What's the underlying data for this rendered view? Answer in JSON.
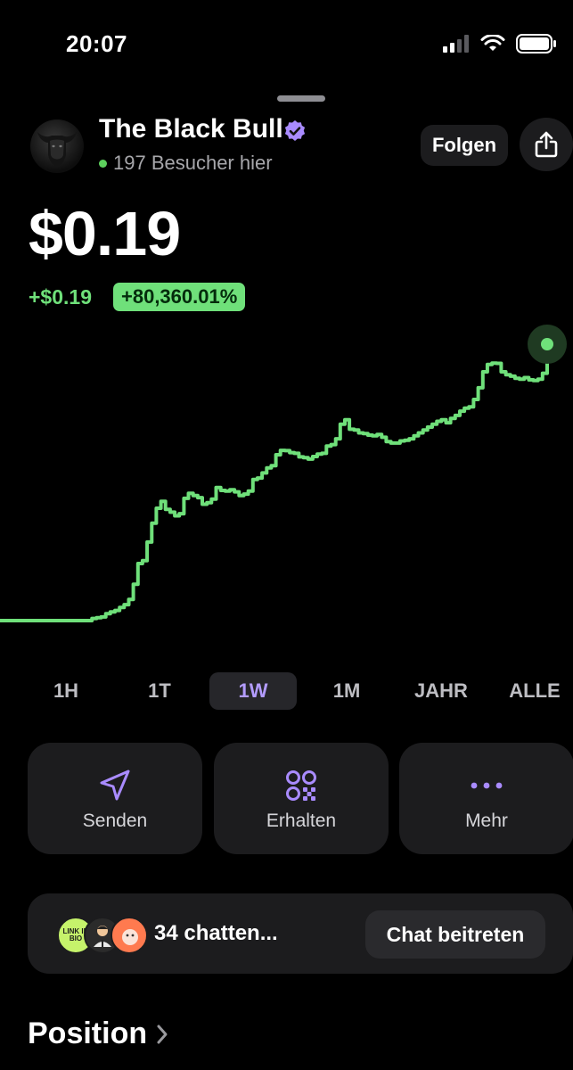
{
  "status_bar": {
    "time": "20:07"
  },
  "token": {
    "name": "The Black Bull",
    "visitors": "197 Besucher hier",
    "follow_label": "Folgen",
    "price": "$0.19",
    "change_abs": "+$0.19",
    "change_pct": "+80,360.01%"
  },
  "time_ranges": [
    {
      "label": "1H"
    },
    {
      "label": "1T"
    },
    {
      "label": "1W",
      "active": true
    },
    {
      "label": "1M"
    },
    {
      "label": "JAHR"
    },
    {
      "label": "ALLE"
    }
  ],
  "actions": {
    "send_label": "Senden",
    "receive_label": "Erhalten",
    "more_label": "Mehr"
  },
  "chat": {
    "count_text": "34 chatten...",
    "join_label": "Chat beitreten",
    "avatar1_text": "LINK IN BIO"
  },
  "position": {
    "title": "Position"
  },
  "colors": {
    "accent_green": "#6fe07a",
    "accent_purple": "#a98bff",
    "background": "#000000",
    "card": "#1c1c1e"
  },
  "chart_data": {
    "type": "line",
    "title": "",
    "xlabel": "",
    "ylabel": "",
    "x": [
      0,
      1,
      2,
      3,
      4,
      5,
      6,
      7,
      8,
      9,
      10,
      11,
      12,
      13,
      14,
      15,
      16,
      17,
      18,
      19,
      20,
      21,
      22,
      23,
      24,
      25,
      26,
      27,
      28,
      29,
      30,
      31,
      32,
      33,
      34,
      35,
      36,
      37,
      38,
      39,
      40,
      41,
      42,
      43,
      44,
      45,
      46,
      47,
      48,
      49,
      50,
      51,
      52,
      53,
      54,
      55,
      56,
      57,
      58,
      59,
      60,
      61,
      62,
      63,
      64,
      65,
      66,
      67,
      68,
      69,
      70,
      71,
      72,
      73,
      74,
      75,
      76,
      77,
      78,
      79,
      80,
      81,
      82,
      83,
      84,
      85,
      86,
      87,
      88,
      89,
      90,
      91,
      92,
      93,
      94,
      95,
      96,
      97,
      98,
      99,
      100,
      101,
      102,
      103,
      104,
      105,
      106,
      107,
      108,
      109,
      110,
      111,
      112,
      113,
      114,
      115,
      116,
      117,
      118,
      119
    ],
    "values": [
      0.0,
      0.0,
      0.0,
      0.0,
      0.0,
      0.0,
      0.0,
      0.0,
      0.0,
      0.0,
      0.0,
      0.0,
      0.0,
      0.0,
      0.0,
      0.0,
      0.0,
      0.0,
      0.0,
      0.0,
      0.0015,
      0.002,
      0.0025,
      0.0048,
      0.006,
      0.007,
      0.009,
      0.011,
      0.0146,
      0.025,
      0.0392,
      0.0412,
      0.054,
      0.067,
      0.0772,
      0.082,
      0.0765,
      0.0745,
      0.072,
      0.0735,
      0.084,
      0.0875,
      0.086,
      0.0845,
      0.08,
      0.081,
      0.0835,
      0.0915,
      0.0895,
      0.089,
      0.09,
      0.0885,
      0.086,
      0.087,
      0.089,
      0.097,
      0.098,
      0.1015,
      0.105,
      0.1065,
      0.114,
      0.117,
      0.1168,
      0.1155,
      0.115,
      0.1125,
      0.112,
      0.111,
      0.1128,
      0.1145,
      0.115,
      0.12,
      0.121,
      0.125,
      0.135,
      0.138,
      0.1315,
      0.131,
      0.129,
      0.1285,
      0.1275,
      0.127,
      0.128,
      0.126,
      0.123,
      0.122,
      0.122,
      0.1235,
      0.124,
      0.125,
      0.127,
      0.129,
      0.131,
      0.133,
      0.135,
      0.137,
      0.138,
      0.136,
      0.139,
      0.141,
      0.144,
      0.146,
      0.147,
      0.152,
      0.16,
      0.171,
      0.176,
      0.177,
      0.1768,
      0.171,
      0.169,
      0.168,
      0.1665,
      0.166,
      0.167,
      0.1655,
      0.165,
      0.166,
      0.17,
      0.19
    ],
    "ylim": [
      0,
      0.19
    ]
  }
}
